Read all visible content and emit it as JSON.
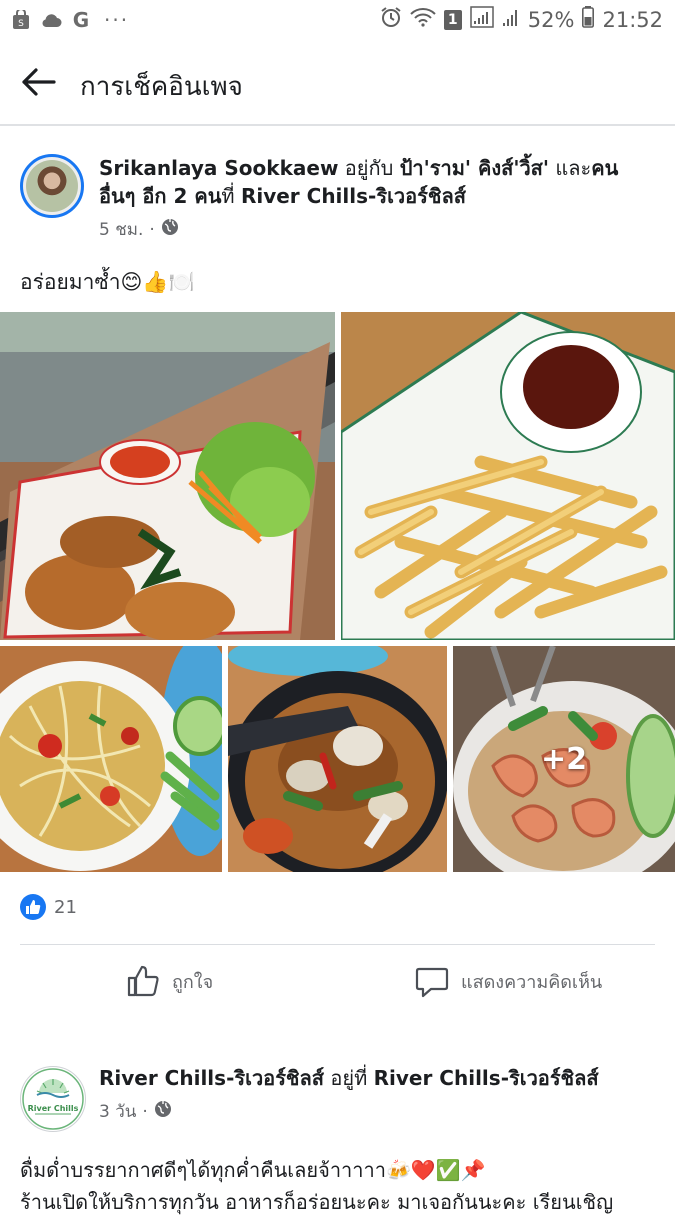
{
  "status_bar": {
    "battery": "52%",
    "time": "21:52",
    "sim_badge": "1",
    "more": "···"
  },
  "app_bar": {
    "title": "การเช็คอินเพจ"
  },
  "post": {
    "author": "Srikanlaya Sookkaew",
    "with_word": "อยู่กับ",
    "tagged": "ป้า'ราม' คิงส์'วิ้ส'",
    "and_word": "และ",
    "others": "คนอื่นๆ อีก 2 คน",
    "at_word": "ที่",
    "place": "River Chills-ริเวอร์ชิลส์",
    "time_ago": "5 ชม.",
    "caption": "อร่อยมาซ้ำ😊👍🍽️",
    "more_photos": "+2",
    "like_count": "21",
    "actions": {
      "like": "ถูกใจ",
      "comment": "แสดงความคิดเห็น"
    }
  },
  "post2": {
    "author": "River Chills-ริเวอร์ชิลส์",
    "at_word": "อยู่ที่",
    "place": "River Chills-ริเวอร์ชิลส์",
    "time_ago": "3 วัน",
    "avatar_text": "River Chills",
    "caption_line1": "ดื่มด่ำบรรยากาศดีๆได้ทุกค่ำคืนเลยจ้าาาาา🍻❤️✅📌",
    "caption_line2": "ร้านเปิดให้บริการทุกวัน อาหารก็อร่อยนะคะ มาเจอกันนะคะ เรียนเชิญ"
  },
  "colors": {
    "fb_blue": "#1877f2",
    "meta_gray": "#65676b"
  }
}
